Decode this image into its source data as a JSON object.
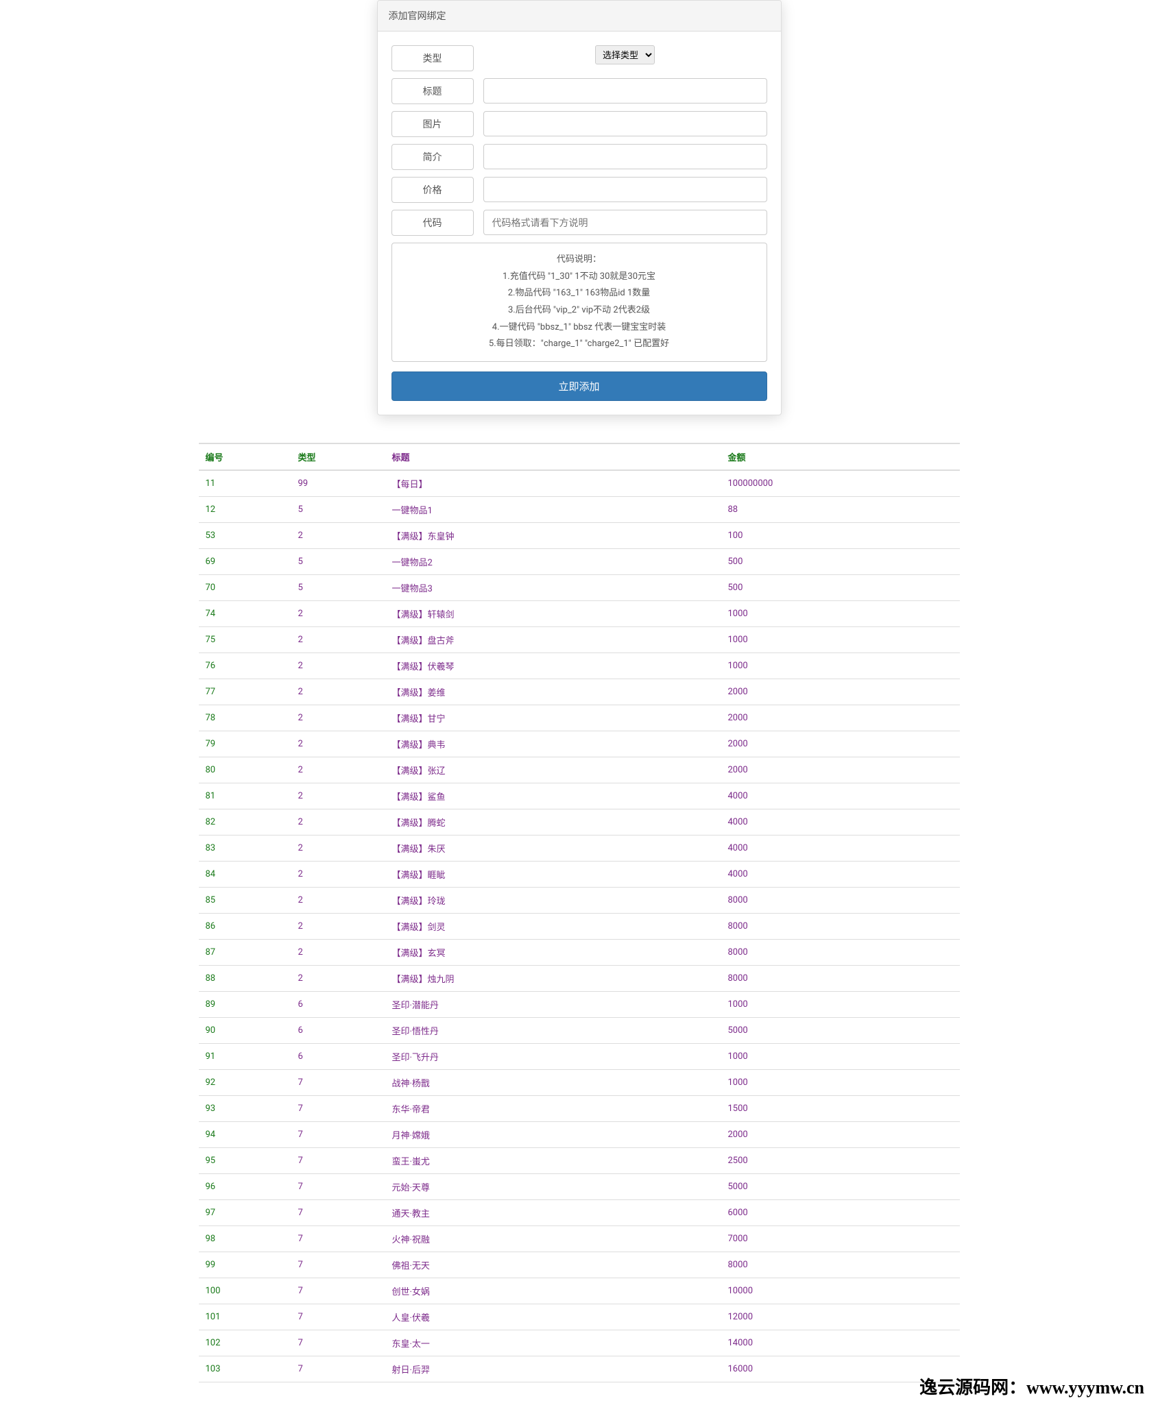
{
  "panel": {
    "title": "添加官网绑定",
    "labels": {
      "type": "类型",
      "title": "标题",
      "image": "图片",
      "intro": "简介",
      "price": "价格",
      "code": "代码"
    },
    "select_placeholder": "选择类型",
    "code_placeholder": "代码格式请看下方说明",
    "help": {
      "heading": "代码说明：",
      "line1": "1.充值代码 \"1_30\" 1不动 30就是30元宝",
      "line2": "2.物品代码 \"163_1\" 163物品id 1数量",
      "line3": "3.后台代码 \"vip_2\" vip不动 2代表2级",
      "line4": "4.一键代码 \"bbsz_1\" bbsz 代表一键宝宝时装",
      "line5": "5.每日领取：\"charge_1\" \"charge2_1\" 已配置好"
    },
    "submit_label": "立即添加"
  },
  "table": {
    "headers": {
      "id": "编号",
      "type": "类型",
      "title": "标题",
      "amount": "金额"
    },
    "rows": [
      {
        "id": "11",
        "type": "99",
        "title": "【每日】",
        "amount": "100000000"
      },
      {
        "id": "12",
        "type": "5",
        "title": "一键物品1",
        "amount": "88"
      },
      {
        "id": "53",
        "type": "2",
        "title": "【满级】东皇钟",
        "amount": "100"
      },
      {
        "id": "69",
        "type": "5",
        "title": "一键物品2",
        "amount": "500"
      },
      {
        "id": "70",
        "type": "5",
        "title": "一键物品3",
        "amount": "500"
      },
      {
        "id": "74",
        "type": "2",
        "title": "【满级】轩辕剑",
        "amount": "1000"
      },
      {
        "id": "75",
        "type": "2",
        "title": "【满级】盘古斧",
        "amount": "1000"
      },
      {
        "id": "76",
        "type": "2",
        "title": "【满级】伏羲琴",
        "amount": "1000"
      },
      {
        "id": "77",
        "type": "2",
        "title": "【满级】姜维",
        "amount": "2000"
      },
      {
        "id": "78",
        "type": "2",
        "title": "【满级】甘宁",
        "amount": "2000"
      },
      {
        "id": "79",
        "type": "2",
        "title": "【满级】典韦",
        "amount": "2000"
      },
      {
        "id": "80",
        "type": "2",
        "title": "【满级】张辽",
        "amount": "2000"
      },
      {
        "id": "81",
        "type": "2",
        "title": "【满级】鲨鱼",
        "amount": "4000"
      },
      {
        "id": "82",
        "type": "2",
        "title": "【满级】腾蛇",
        "amount": "4000"
      },
      {
        "id": "83",
        "type": "2",
        "title": "【满级】朱厌",
        "amount": "4000"
      },
      {
        "id": "84",
        "type": "2",
        "title": "【满级】睚眦",
        "amount": "4000"
      },
      {
        "id": "85",
        "type": "2",
        "title": "【满级】玲珑",
        "amount": "8000"
      },
      {
        "id": "86",
        "type": "2",
        "title": "【满级】剑灵",
        "amount": "8000"
      },
      {
        "id": "87",
        "type": "2",
        "title": "【满级】玄冥",
        "amount": "8000"
      },
      {
        "id": "88",
        "type": "2",
        "title": "【满级】烛九阴",
        "amount": "8000"
      },
      {
        "id": "89",
        "type": "6",
        "title": "圣印·潜能丹",
        "amount": "1000"
      },
      {
        "id": "90",
        "type": "6",
        "title": "圣印·悟性丹",
        "amount": "5000"
      },
      {
        "id": "91",
        "type": "6",
        "title": "圣印·飞升丹",
        "amount": "1000"
      },
      {
        "id": "92",
        "type": "7",
        "title": "战神·杨戬",
        "amount": "1000"
      },
      {
        "id": "93",
        "type": "7",
        "title": "东华·帝君",
        "amount": "1500"
      },
      {
        "id": "94",
        "type": "7",
        "title": "月神·嫦娥",
        "amount": "2000"
      },
      {
        "id": "95",
        "type": "7",
        "title": "蛮王·蚩尤",
        "amount": "2500"
      },
      {
        "id": "96",
        "type": "7",
        "title": "元始·天尊",
        "amount": "5000"
      },
      {
        "id": "97",
        "type": "7",
        "title": "通天·教主",
        "amount": "6000"
      },
      {
        "id": "98",
        "type": "7",
        "title": "火神·祝融",
        "amount": "7000"
      },
      {
        "id": "99",
        "type": "7",
        "title": "佛祖·无天",
        "amount": "8000"
      },
      {
        "id": "100",
        "type": "7",
        "title": "创世·女娲",
        "amount": "10000"
      },
      {
        "id": "101",
        "type": "7",
        "title": "人皇·伏羲",
        "amount": "12000"
      },
      {
        "id": "102",
        "type": "7",
        "title": "东皇·太一",
        "amount": "14000"
      },
      {
        "id": "103",
        "type": "7",
        "title": "射日·后羿",
        "amount": "16000"
      }
    ]
  },
  "watermark": "逸云源码网：www.yyymw.cn"
}
